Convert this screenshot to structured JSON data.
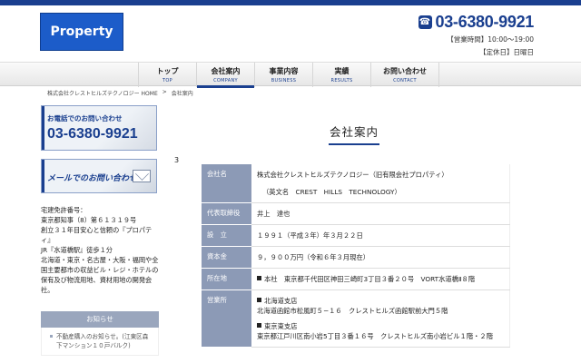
{
  "header": {
    "logo_text": "Property",
    "phone": "03-6380-9921",
    "hours_line": "【営業時間】10:00〜19:00",
    "holiday_line": "【定休日】日曜日"
  },
  "nav": [
    {
      "jp": "トップ",
      "en": "TOP"
    },
    {
      "jp": "会社案内",
      "en": "COMPANY"
    },
    {
      "jp": "事業内容",
      "en": "BUSINESS"
    },
    {
      "jp": "実績",
      "en": "RESULTS"
    },
    {
      "jp": "お問い合わせ",
      "en": "CONTACT"
    }
  ],
  "breadcrumb": {
    "home": "株式会社クレストヒルズテクノロジー HOME",
    "sep": ">",
    "current": "会社案内"
  },
  "sidebar": {
    "tel_caption": "お電話でのお問い合わせ",
    "tel_number": "03-6380-9921",
    "mail_caption": "メールでのお問い合わせ",
    "license_lines": [
      "宅建免許番号：",
      "東京都知事（8）第６１３１９号",
      "創立３１年目安心と信頼の『プロパティ』",
      "JR『水道橋駅』徒歩１分",
      "北海道・東京・名古屋・大阪・福岡や全国主要都市の収益ビル・レジ・ホテルの保有及び物流用地、資材用地の開発会社。"
    ],
    "notice_title": "お知らせ",
    "notice_item": "不動産購入のお知らせ。(江東区森下マンション１０戸バルク)"
  },
  "stray_text": "3",
  "main": {
    "title": "会社案内",
    "rows": [
      {
        "label": "会社名",
        "value": "株式会社クレストヒルズテクノロジー（旧有限会社プロパティ）",
        "sub": "（英文名　CREST　HILLS　TECHNOLOGY）"
      },
      {
        "label": "代表取締役",
        "value": "井上　達也"
      },
      {
        "label": "設　立",
        "value": "１９９１（平成３年）年３月２２日"
      },
      {
        "label": "資本金",
        "value": "９，９００万円（令和６年３月現在）"
      },
      {
        "label": "所在地",
        "value": "本社　東京都千代田区神田三崎町3丁目３番２０号　VORT水道橋Ⅱ８階"
      },
      {
        "label": "営業所",
        "offices": [
          {
            "name": "北海道支店",
            "addr": "北海道函館市松風町５−１６　クレストヒルズ函館駅前大門５階"
          },
          {
            "name": "東京東支店",
            "addr": "東京都江戸川区南小岩5丁目３番１６号　クレストヒルズ南小岩ビル１階・２階"
          }
        ]
      }
    ]
  }
}
